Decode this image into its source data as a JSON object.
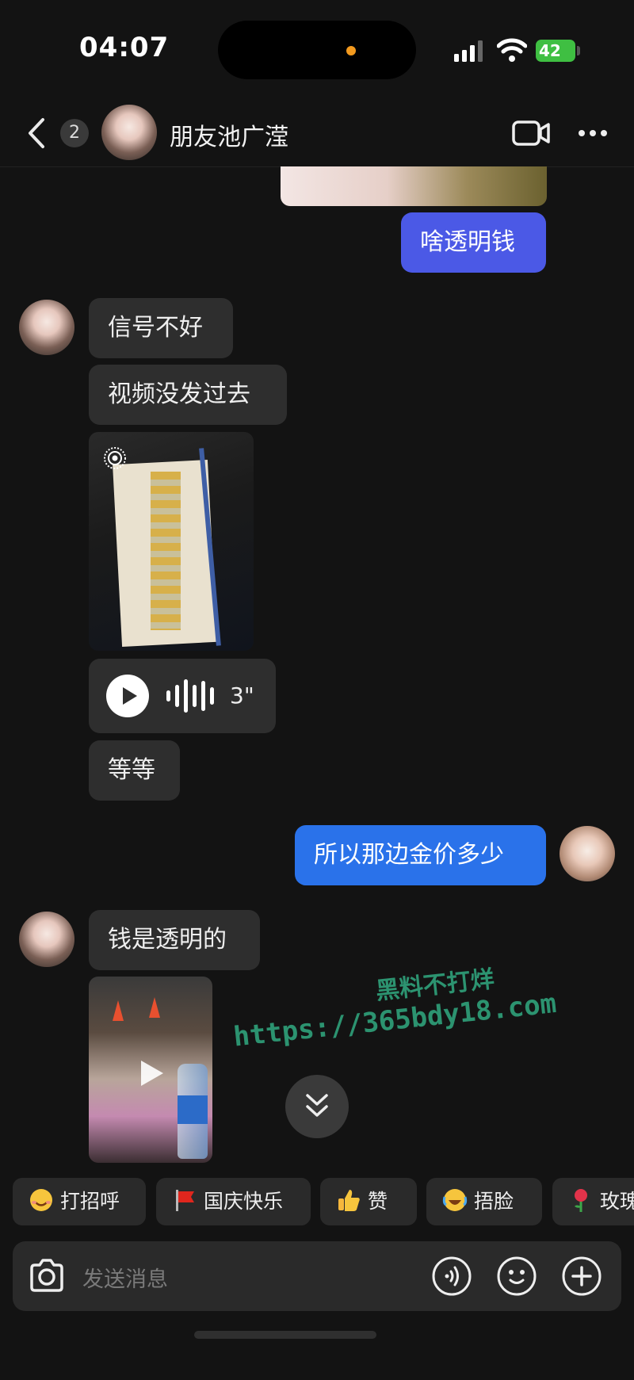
{
  "status_bar": {
    "time": "04:07",
    "battery": "42"
  },
  "header": {
    "unread_count": "2",
    "contact_name": "朋友池广滢"
  },
  "messages": {
    "m1": "啥透明钱",
    "m2": "信号不好",
    "m3": "视频没发过去",
    "voice_duration": "3\"",
    "m4": "等等",
    "m5": "所以那边金价多少",
    "m6": "钱是透明的"
  },
  "watermark": {
    "line1": "黑料不打烊",
    "line2": "https://365bdy18.com"
  },
  "quick_replies": [
    "打招呼",
    "国庆快乐",
    "赞",
    "捂脸",
    "玫瑰"
  ],
  "input": {
    "placeholder": "发送消息"
  },
  "colors": {
    "background": "#131313",
    "bubble_incoming": "#2e2e2e",
    "bubble_outgoing_purple": "#4b59e6",
    "bubble_outgoing_blue": "#2a72ea",
    "battery_green": "#3fbf42"
  },
  "icons": [
    "back-icon",
    "video-call-icon",
    "more-icon",
    "live-photo-icon",
    "play-icon",
    "sound-wave-icon",
    "chevron-double-down-icon",
    "camera-icon",
    "voice-input-icon",
    "emoji-icon",
    "plus-icon"
  ]
}
